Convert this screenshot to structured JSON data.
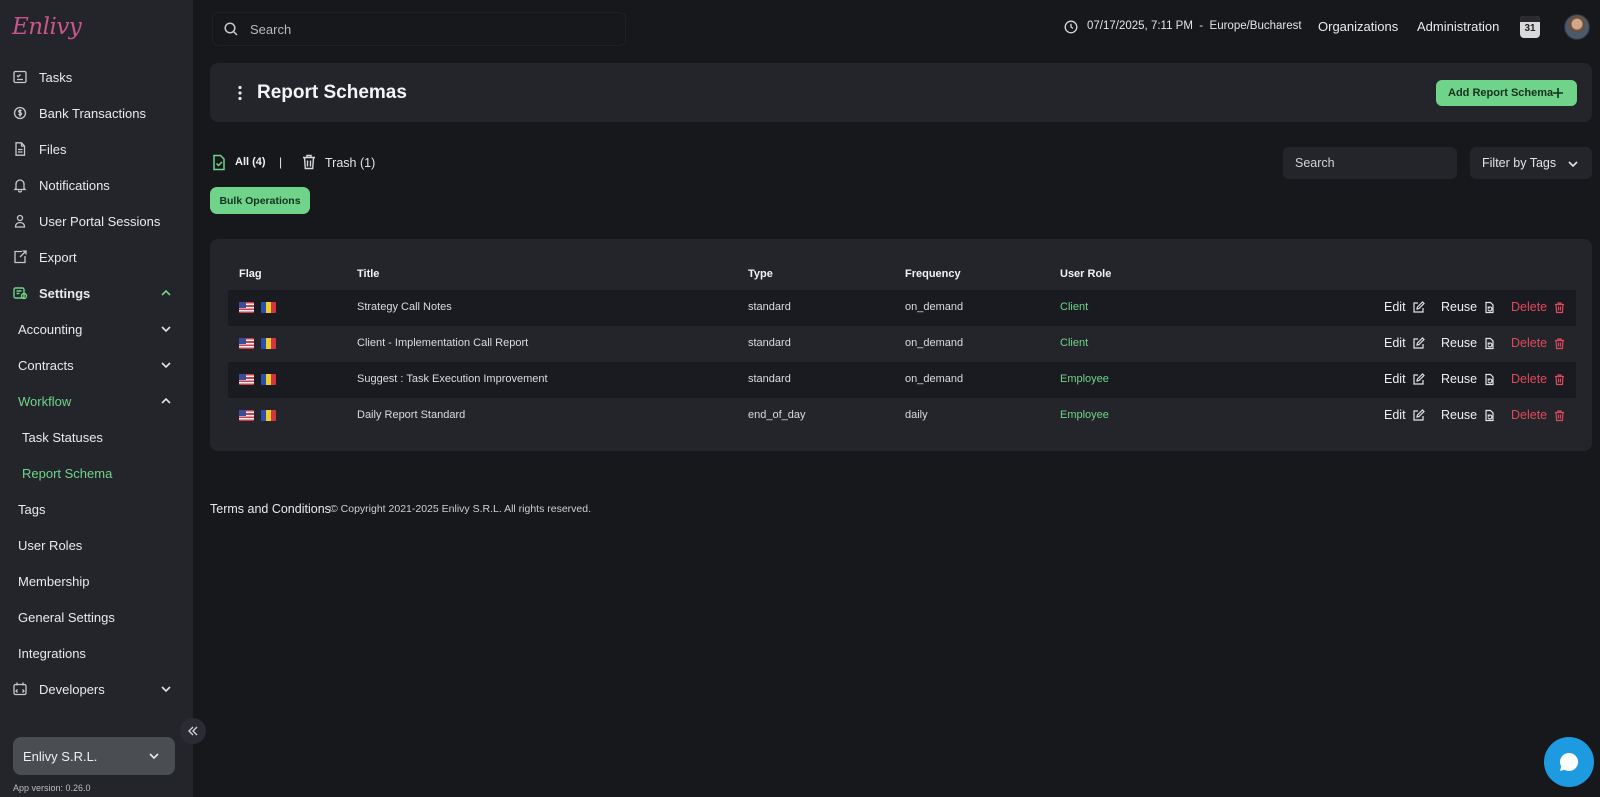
{
  "brand": {
    "logo_text": "Enlivy"
  },
  "sidebar": {
    "items": [
      {
        "label": "Tasks",
        "icon": "tasks-icon"
      },
      {
        "label": "Bank Transactions",
        "icon": "bank-icon"
      },
      {
        "label": "Files",
        "icon": "file-icon"
      },
      {
        "label": "Notifications",
        "icon": "bell-icon"
      },
      {
        "label": "User Portal Sessions",
        "icon": "portal-icon"
      },
      {
        "label": "Export",
        "icon": "export-icon"
      },
      {
        "label": "Settings",
        "icon": "settings-icon",
        "expanded": true
      },
      {
        "label": "Accounting"
      },
      {
        "label": "Contracts"
      },
      {
        "label": "Workflow",
        "expanded": true
      },
      {
        "label": "Task Statuses"
      },
      {
        "label": "Report Schema",
        "active": true
      },
      {
        "label": "Tags"
      },
      {
        "label": "User Roles"
      },
      {
        "label": "Membership"
      },
      {
        "label": "General Settings"
      },
      {
        "label": "Integrations"
      },
      {
        "label": "Developers",
        "icon": "developers-icon"
      }
    ],
    "organization": "Enlivy S.R.L.",
    "app_version": "App version: 0.26.0"
  },
  "topbar": {
    "search_placeholder": "Search",
    "datetime": "07/17/2025, 7:11 PM  -  Europe/Bucharest",
    "links": [
      "Organizations",
      "Administration"
    ],
    "calendar_day": "31"
  },
  "header": {
    "title": "Report Schemas",
    "add_label": "Add Report Schema"
  },
  "tabs": {
    "all_label": "All (4)",
    "separator": "|",
    "trash_label": "Trash (1)"
  },
  "bulk_label": "Bulk Operations",
  "search_placeholder": "Search",
  "filter_label": "Filter by Tags",
  "table": {
    "columns": [
      "Flag",
      "Title",
      "Type",
      "Frequency",
      "User Role"
    ],
    "rows": [
      {
        "title": "Strategy Call Notes",
        "type": "standard",
        "frequency": "on_demand",
        "role": "Client"
      },
      {
        "title": "Client - Implementation Call Report",
        "type": "standard",
        "frequency": "on_demand",
        "role": "Client"
      },
      {
        "title": "Suggest : Task Execution Improvement",
        "type": "standard",
        "frequency": "on_demand",
        "role": "Employee"
      },
      {
        "title": "Daily Report Standard",
        "type": "end_of_day",
        "frequency": "daily",
        "role": "Employee"
      }
    ],
    "actions": {
      "edit": "Edit",
      "reuse": "Reuse",
      "delete": "Delete"
    }
  },
  "footer": {
    "terms": "Terms and Conditions",
    "copyright": "© Copyright 2021-2025 Enlivy S.R.L. All rights reserved."
  },
  "colors": {
    "accent": "#6fd48a",
    "danger": "#e0485c",
    "chat": "#1e9be0",
    "background": "#17181c",
    "panel": "#24252b"
  }
}
